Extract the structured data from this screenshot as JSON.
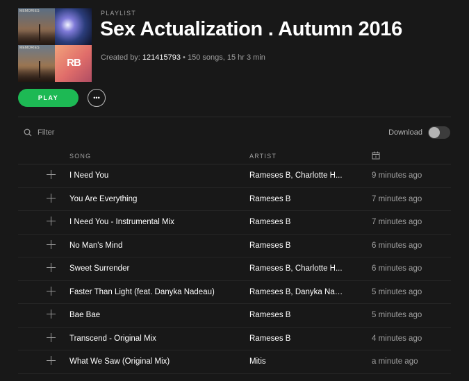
{
  "header": {
    "label": "PLAYLIST",
    "title": "Sex Actualization . Autumn 2016",
    "created_by_label": "Created by: ",
    "creator": "121415793",
    "stats": " • 150 songs, 15 hr 3 min",
    "cover_tags": [
      "MEMORIES",
      "MEMORIES"
    ],
    "cover_logo": "RB"
  },
  "actions": {
    "play_label": "PLAY",
    "more_label": "•••"
  },
  "toolbar": {
    "filter_placeholder": "Filter",
    "download_label": "Download",
    "download_enabled": false
  },
  "table": {
    "columns": {
      "song": "SONG",
      "artist": "ARTIST",
      "added_icon": "calendar-icon"
    },
    "rows": [
      {
        "title": "I Need You",
        "artist": "Rameses B, Charlotte H...",
        "added": "9 minutes ago"
      },
      {
        "title": "You Are Everything",
        "artist": "Rameses B",
        "added": "7 minutes ago"
      },
      {
        "title": "I Need You - Instrumental Mix",
        "artist": "Rameses B",
        "added": "7 minutes ago"
      },
      {
        "title": "No Man's Mind",
        "artist": "Rameses B",
        "added": "6 minutes ago"
      },
      {
        "title": "Sweet Surrender",
        "artist": "Rameses B, Charlotte H...",
        "added": "6 minutes ago"
      },
      {
        "title": "Faster Than Light (feat. Danyka Nadeau)",
        "artist": "Rameses B, Danyka Nad...",
        "added": "5 minutes ago"
      },
      {
        "title": "Bae Bae",
        "artist": "Rameses B",
        "added": "5 minutes ago"
      },
      {
        "title": "Transcend - Original Mix",
        "artist": "Rameses B",
        "added": "4 minutes ago"
      },
      {
        "title": "What We Saw (Original Mix)",
        "artist": "Mitis",
        "added": "a minute ago"
      }
    ]
  },
  "colors": {
    "background": "#181818",
    "accent": "#1db954",
    "text_primary": "#ffffff",
    "text_secondary": "#a0a0a0"
  }
}
